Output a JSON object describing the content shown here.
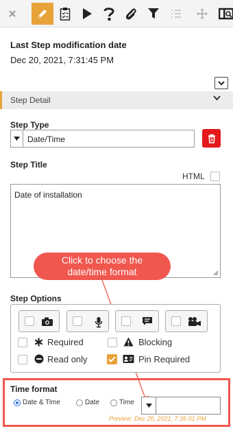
{
  "toolbar": {
    "icons": [
      "close-icon",
      "pencil-icon",
      "checklist-icon",
      "play-icon",
      "question-icon",
      "paperclip-icon",
      "filter-icon",
      "list-icon",
      "move-icon",
      "panel-icon"
    ]
  },
  "last_modification": {
    "label": "Last Step modification date",
    "value": "Dec 20, 2021, 7:31:45 PM"
  },
  "step_detail": {
    "label": "Step Detail"
  },
  "step_type": {
    "label": "Step Type",
    "value": "Date/Time"
  },
  "step_title": {
    "label": "Step Title",
    "html_label": "HTML",
    "value": "Date of installation"
  },
  "callout": {
    "text": "Click to choose the date/time format"
  },
  "step_options": {
    "label": "Step Options",
    "media": [
      "camera-icon",
      "microphone-icon",
      "comment-icon",
      "video-icon"
    ],
    "options": [
      {
        "label": "Required",
        "checked": false
      },
      {
        "label": "Blocking",
        "checked": false
      },
      {
        "label": "Read only",
        "checked": false
      },
      {
        "label": "Pin Required",
        "checked": true
      }
    ]
  },
  "time_format": {
    "label": "Time format",
    "choices": [
      {
        "label": "Date & Time",
        "selected": true
      },
      {
        "label": "Date",
        "selected": false
      },
      {
        "label": "Time",
        "selected": false
      }
    ],
    "preview": "Preview: Dec 20, 2021, 7:35:01 PM"
  },
  "colors": {
    "accent": "#e8a23a",
    "annotation": "#f0574f",
    "delete": "#e3191b",
    "radio": "#2d6cdf"
  }
}
